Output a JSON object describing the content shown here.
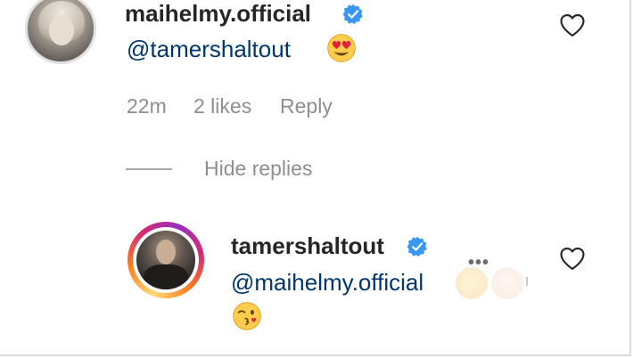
{
  "comment": {
    "username": "maihelmy.official",
    "mention": "@tamershaltout",
    "emoji": "heart-eyes-emoji",
    "time": "22m",
    "likes": "2 likes",
    "reply_label": "Reply",
    "hide_replies_label": "Hide replies"
  },
  "reply": {
    "username": "tamershaltout",
    "mention": "@maihelmy.official",
    "emoji": "winking-kiss-emoji"
  },
  "colors": {
    "verified": "#3897f0",
    "mention": "#00376b",
    "muted": "#8e8e8e",
    "text": "#262626"
  }
}
